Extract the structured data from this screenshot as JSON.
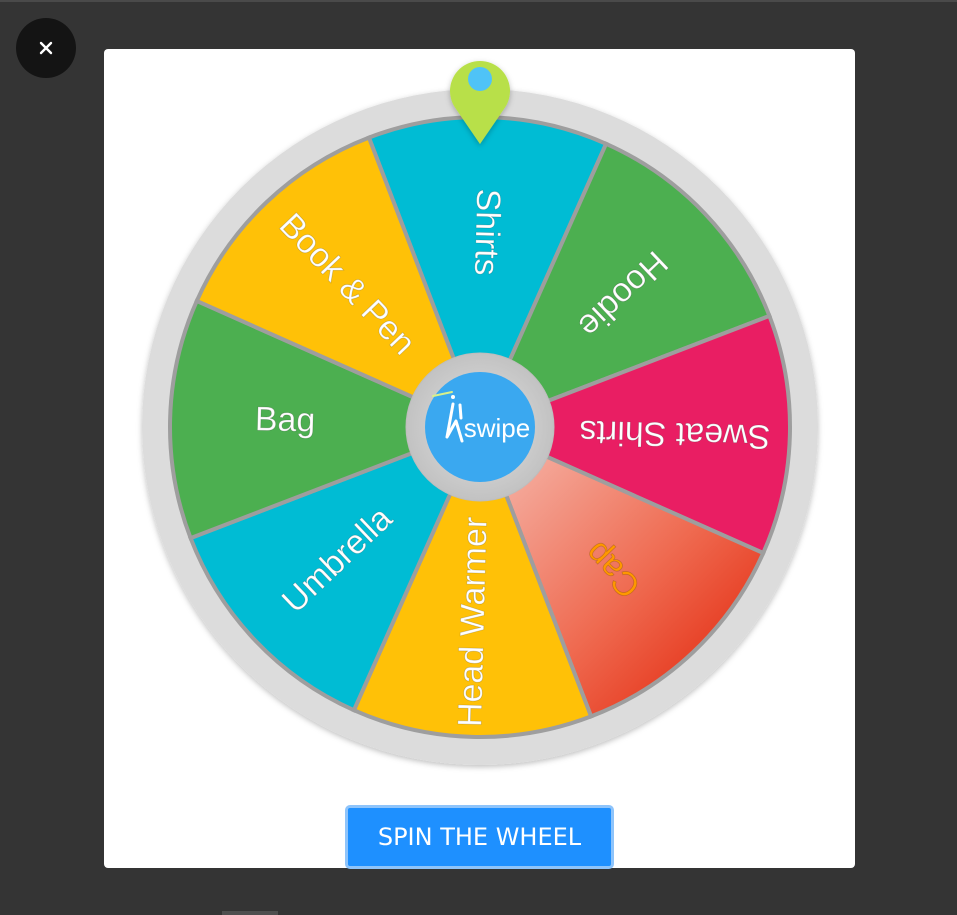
{
  "close_button": {
    "glyph": "✕",
    "icon": "close-icon"
  },
  "wheel": {
    "segments": [
      {
        "label": "Shirts",
        "color": "#00bcd4",
        "text_color": "#ffffff"
      },
      {
        "label": "Hoodie",
        "color": "#4caf50",
        "text_color": "#ffffff"
      },
      {
        "label": "Sweat Shirts",
        "color": "#e91e63",
        "text_color": "#ffffff"
      },
      {
        "label": "Cap",
        "color": "gradient-red",
        "text_color": "#ff9800"
      },
      {
        "label": "Head Warmer",
        "color": "#ffc107",
        "text_color": "#ffffff"
      },
      {
        "label": "Umbrella",
        "color": "#00bcd4",
        "text_color": "#ffffff"
      },
      {
        "label": "Bag",
        "color": "#4caf50",
        "text_color": "#ffffff"
      },
      {
        "label": "Book & Pen",
        "color": "#ffc107",
        "text_color": "#ffffff"
      }
    ],
    "center_logo": {
      "text": "swipe",
      "icon": "swipe-logo-icon",
      "color": "#3aa8f0"
    },
    "pointer": {
      "icon": "map-pin-pointer-icon",
      "color": "#b8e04a",
      "dot_color": "#4fc3f7"
    },
    "rim_color": "#dcdcdc",
    "divider_color": "#9e9e9e"
  },
  "spin_button": {
    "label": "SPIN THE WHEEL",
    "color": "#1e90ff"
  }
}
